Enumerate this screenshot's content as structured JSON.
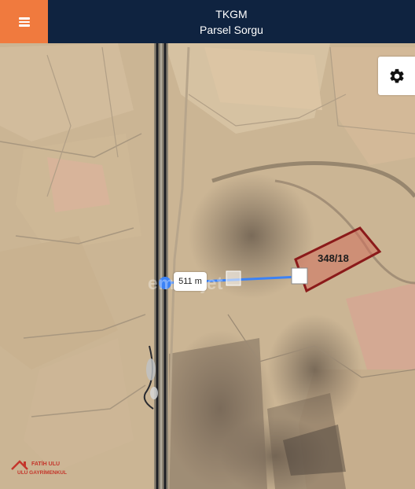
{
  "header": {
    "title": "TKGM",
    "subtitle": "Parsel Sorgu"
  },
  "icons": {
    "menu": "menu-icon",
    "settings": "gear-icon"
  },
  "map": {
    "parcel_label": "348/18",
    "measure_distance": "511 m",
    "watermark": "emlakjet",
    "logo_name": "FATİH ULU",
    "logo_tagline": "ULU GAYRİMENKUL"
  },
  "colors": {
    "header_bg": "#0f2340",
    "menu_button": "#f07a3e",
    "parcel_outline": "#8b1a1a",
    "parcel_fill": "#d2705c",
    "measure_line": "#3b82f6"
  }
}
